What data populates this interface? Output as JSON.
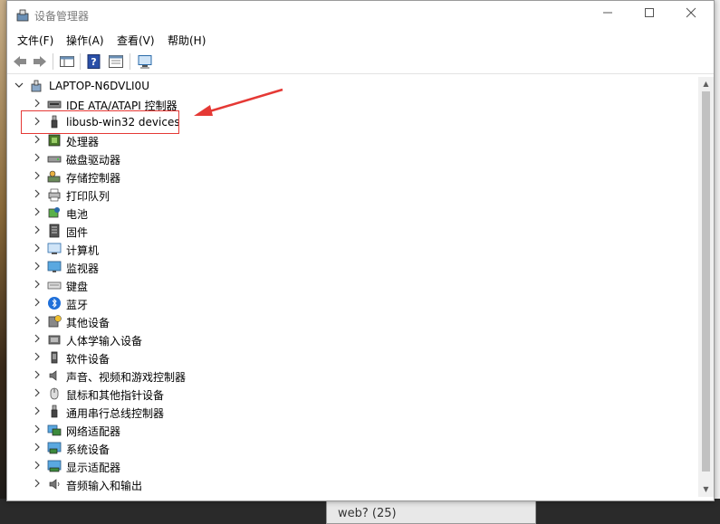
{
  "window": {
    "title": "设备管理器"
  },
  "menu": [
    "文件(F)",
    "操作(A)",
    "查看(V)",
    "帮助(H)"
  ],
  "tree": {
    "root": "LAPTOP-N6DVLI0U",
    "items": [
      {
        "label": "IDE ATA/ATAPI 控制器",
        "icon": "ide-controller-icon"
      },
      {
        "label": "libusb-win32 devices",
        "icon": "usb-plug-icon"
      },
      {
        "label": "处理器",
        "icon": "processor-icon"
      },
      {
        "label": "磁盘驱动器",
        "icon": "disk-drive-icon"
      },
      {
        "label": "存储控制器",
        "icon": "storage-controller-icon"
      },
      {
        "label": "打印队列",
        "icon": "printer-icon"
      },
      {
        "label": "电池",
        "icon": "battery-icon"
      },
      {
        "label": "固件",
        "icon": "firmware-icon"
      },
      {
        "label": "计算机",
        "icon": "computer-icon"
      },
      {
        "label": "监视器",
        "icon": "monitor-icon"
      },
      {
        "label": "键盘",
        "icon": "keyboard-icon"
      },
      {
        "label": "蓝牙",
        "icon": "bluetooth-icon"
      },
      {
        "label": "其他设备",
        "icon": "other-devices-icon"
      },
      {
        "label": "人体学输入设备",
        "icon": "hid-icon"
      },
      {
        "label": "软件设备",
        "icon": "software-device-icon"
      },
      {
        "label": "声音、视频和游戏控制器",
        "icon": "speaker-icon"
      },
      {
        "label": "鼠标和其他指针设备",
        "icon": "mouse-icon"
      },
      {
        "label": "通用串行总线控制器",
        "icon": "usb-controller-icon"
      },
      {
        "label": "网络适配器",
        "icon": "network-adapter-icon"
      },
      {
        "label": "系统设备",
        "icon": "system-device-icon"
      },
      {
        "label": "显示适配器",
        "icon": "display-adapter-icon"
      },
      {
        "label": "音频输入和输出",
        "icon": "audio-io-icon"
      }
    ]
  },
  "taskbar": {
    "item": "web? (25)"
  },
  "colors": {
    "highlight": "#e53935",
    "accent": "#0078d7"
  }
}
